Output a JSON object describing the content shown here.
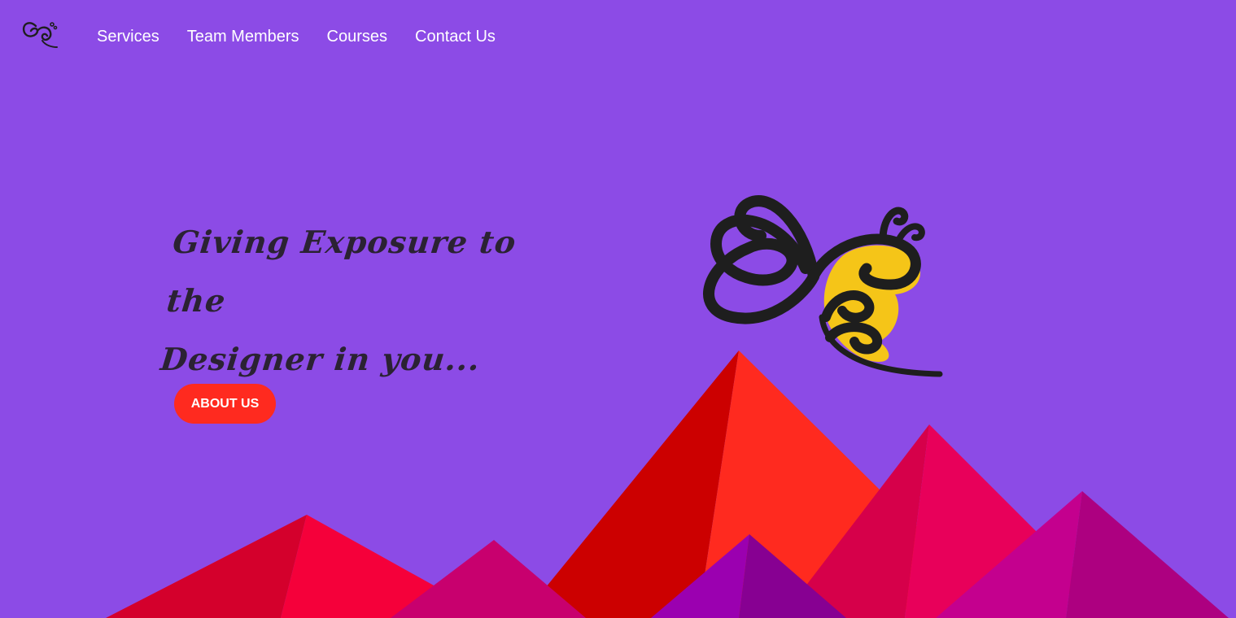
{
  "nav": {
    "logo_icon": "bee-logo-icon",
    "links": [
      {
        "label": "Services"
      },
      {
        "label": "Team Members"
      },
      {
        "label": "Courses"
      },
      {
        "label": "Contact Us"
      }
    ]
  },
  "hero": {
    "heading_line1": "Giving Exposure to the",
    "heading_line2": "Designer in you...",
    "cta_label": "ABOUT US",
    "illustration": "bee-illustration"
  },
  "colors": {
    "background": "#8c4be6",
    "cta": "#ff2a1f",
    "bee_body": "#1e1e1e",
    "bee_wing": "#f5c518",
    "mountain_red": "#ff2a1f",
    "mountain_dark_red": "#cc0000",
    "mountain_pink": "#e8005a",
    "mountain_magenta": "#c4008e",
    "mountain_purple": "#9b00b0"
  }
}
